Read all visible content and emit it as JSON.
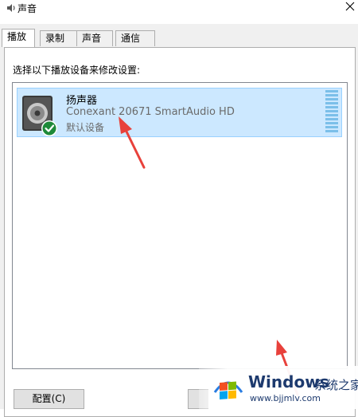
{
  "window": {
    "title": "声音",
    "icon": "speaker-icon",
    "close": "close-icon"
  },
  "tabs": [
    {
      "label": "播放",
      "active": true
    },
    {
      "label": "录制",
      "active": false
    },
    {
      "label": "声音",
      "active": false
    },
    {
      "label": "通信",
      "active": false
    }
  ],
  "playback": {
    "instruction": "选择以下播放设备来修改设置:",
    "devices": [
      {
        "name": "扬声器",
        "description": "Conexant 20671 SmartAudio HD",
        "status": "默认设备",
        "icon": "speaker-device-icon",
        "badge": "default-check-icon",
        "selected": true
      }
    ]
  },
  "buttons": {
    "configure": "配置(C)"
  },
  "watermark": {
    "brand": "Windows",
    "suffix": "系统之家",
    "url": "www.bjjmlv.com"
  },
  "colors": {
    "selection": "#cce8ff",
    "selection_border": "#99d1ff",
    "annotation_arrow": "#e8413b",
    "check_badge": "#1e8a3a",
    "watermark_text": "#1d3a6e"
  }
}
